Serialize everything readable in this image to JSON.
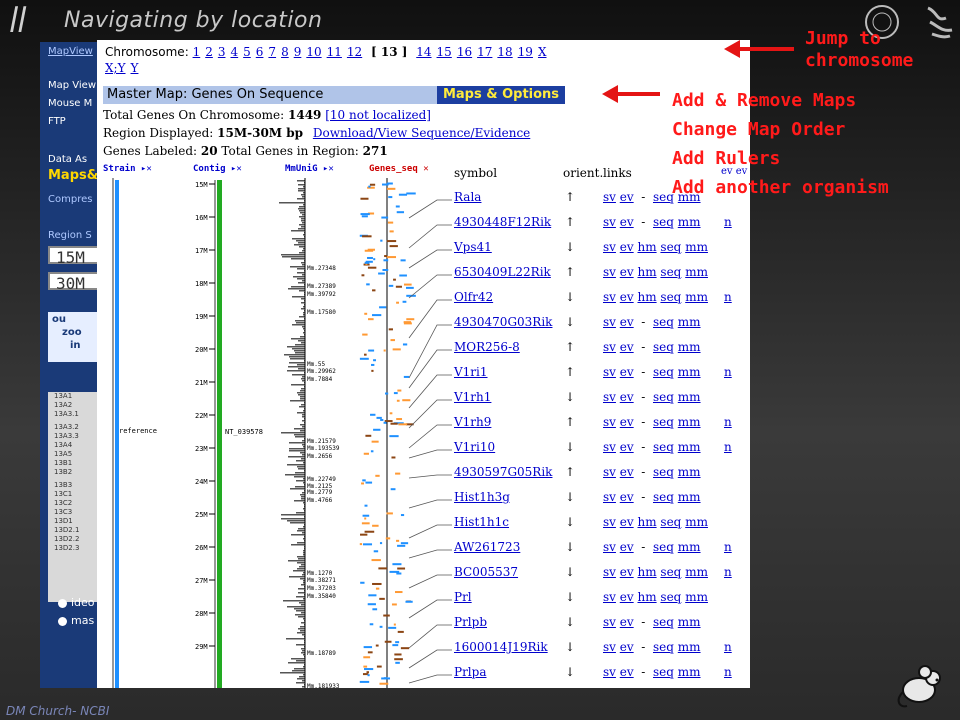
{
  "slide": {
    "title": "Navigating by location",
    "footer": "DM Church- NCBI",
    "annotations": {
      "jump": [
        "Jump to",
        "chromosome"
      ],
      "maps": [
        "Add & Remove Maps",
        "Change Map Order",
        "Add Rulers",
        "Add another organism"
      ]
    }
  },
  "sidebar": {
    "top_link": "MapView",
    "items": [
      "Map View",
      "Mouse M",
      "FTP"
    ],
    "data_as": "Data As",
    "maps_label": "Maps&",
    "compress": "Compres",
    "region": "Region S",
    "region_start": "15M",
    "region_end": "30M",
    "tools": [
      "ou",
      "zoo",
      "in"
    ],
    "bands": [
      "13A1",
      "13A2",
      "13A3.1",
      "13A3.2",
      "13A3.3",
      "13A4",
      "13A5",
      "13B1",
      "13B2",
      "13B3",
      "13C1",
      "13C2",
      "13C3",
      "13D1",
      "13D2.1",
      "13D2.2",
      "13D2.3"
    ],
    "radio1": "ideo",
    "radio2": "mas"
  },
  "chromosome_nav": {
    "label": "Chromosome:",
    "numbers_before": [
      "1",
      "2",
      "3",
      "4",
      "5",
      "6",
      "7",
      "8",
      "9",
      "10",
      "11",
      "12"
    ],
    "current": "[ 13 ]",
    "numbers_after": [
      "14",
      "15",
      "16",
      "17",
      "18",
      "19",
      "X"
    ],
    "second_line": [
      "X;Y",
      "Y"
    ]
  },
  "map_bar": {
    "title": "Master Map: Genes On Sequence",
    "options": "Maps & Options"
  },
  "summary": {
    "total_genes_label": "Total Genes On Chromosome: ",
    "total_genes": "1449",
    "not_localized": "[10 not localized]",
    "region_label": "Region Displayed: ",
    "region_value": "15M-30M bp",
    "download": "Download/View Sequence/Evidence",
    "labeled_label": "Genes Labeled: ",
    "labeled_value": "20",
    "region_total_label": " Total Genes in Region: ",
    "region_total": "271"
  },
  "tracks": {
    "strain": "Strain",
    "contig": "Contig",
    "mmunig": "MmUniG",
    "genes_seq": "Genes_seq"
  },
  "table_headers": {
    "symbol": "symbol",
    "orient": "orient.",
    "links": "links",
    "ev": "ev ev"
  },
  "genes": [
    {
      "symbol": "Rala",
      "orient": "↑",
      "links": "sv ev  -  seq mm",
      "n": ""
    },
    {
      "symbol": "4930448F12Rik",
      "orient": "↑",
      "links": "sv ev  -  seq mm",
      "n": "n"
    },
    {
      "symbol": "Vps41",
      "orient": "↓",
      "links": "sv ev hm seq mm",
      "n": ""
    },
    {
      "symbol": "6530409L22Rik",
      "orient": "↑",
      "links": "sv ev hm seq mm",
      "n": ""
    },
    {
      "symbol": "Olfr42",
      "orient": "↓",
      "links": "sv ev hm seq mm",
      "n": "n"
    },
    {
      "symbol": "4930470G03Rik",
      "orient": "↓",
      "links": "sv ev  -  seq mm",
      "n": ""
    },
    {
      "symbol": "MOR256-8",
      "orient": "↑",
      "links": "sv ev  -  seq mm",
      "n": ""
    },
    {
      "symbol": "V1ri1",
      "orient": "↑",
      "links": "sv ev  -  seq mm",
      "n": "n"
    },
    {
      "symbol": "V1rh1",
      "orient": "↓",
      "links": "sv ev  -  seq mm",
      "n": ""
    },
    {
      "symbol": "V1rh9",
      "orient": "↑",
      "links": "sv ev  -  seq mm",
      "n": "n"
    },
    {
      "symbol": "V1ri10",
      "orient": "↓",
      "links": "sv ev  -  seq mm",
      "n": "n"
    },
    {
      "symbol": "4930597G05Rik",
      "orient": "↑",
      "links": "sv ev  -  seq mm",
      "n": ""
    },
    {
      "symbol": "Hist1h3g",
      "orient": "↓",
      "links": "sv ev  -  seq mm",
      "n": ""
    },
    {
      "symbol": "Hist1h1c",
      "orient": "↓",
      "links": "sv ev hm seq mm",
      "n": ""
    },
    {
      "symbol": "AW261723",
      "orient": "↓",
      "links": "sv ev  -  seq mm",
      "n": "n"
    },
    {
      "symbol": "BC005537",
      "orient": "↓",
      "links": "sv ev hm seq mm",
      "n": "n"
    },
    {
      "symbol": "Prl",
      "orient": "↓",
      "links": "sv ev hm seq mm",
      "n": ""
    },
    {
      "symbol": "Prlpb",
      "orient": "↓",
      "links": "sv ev  -  seq mm",
      "n": ""
    },
    {
      "symbol": "1600014J19Rik",
      "orient": "↓",
      "links": "sv ev  -  seq mm",
      "n": "n"
    },
    {
      "symbol": "Prlpa",
      "orient": "↓",
      "links": "sv ev  -  seq mm",
      "n": "n"
    }
  ],
  "ruler_ticks": [
    "15M",
    "16M",
    "17M",
    "18M",
    "19M",
    "20M",
    "21M",
    "22M",
    "23M",
    "24M",
    "25M",
    "26M",
    "27M",
    "28M",
    "29M"
  ],
  "contig_label": "NT_039578",
  "strain_label": "reference",
  "unigene_labels": [
    "Mm.27348",
    "Mm.27389",
    "Mm.39792",
    "Mm.17580",
    "Mm.55",
    "Mm.29962",
    "Mm.7884",
    "Mm.21579",
    "Mm.193539",
    "Mm.2656",
    "Mm.22749",
    "Mm.2125",
    "Mm.2779",
    "Mm.4766",
    "Mm.1270",
    "Mm.38271",
    "Mm.37203",
    "Mm.35840",
    "Mm.18789",
    "Mm.181933"
  ],
  "colors": {
    "accent_red": "#ff1a1a",
    "nav_blue": "#1a3a78",
    "link_blue": "#0000cc",
    "options_yellow": "#ffeb3b"
  }
}
